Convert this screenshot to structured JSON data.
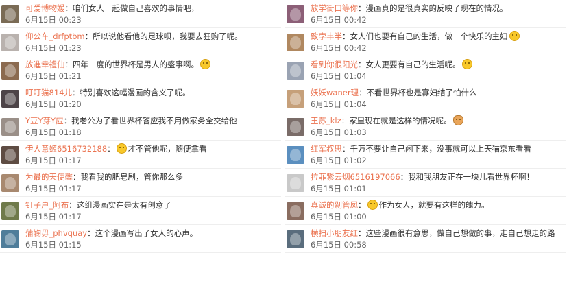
{
  "left": [
    {
      "user": "可爱博物嫒",
      "text": "咱们女人一起做自己喜欢的事情吧，",
      "emoji": "",
      "after": "",
      "date": "6月15日 00:23",
      "avatar": "#7a6b55"
    },
    {
      "user": "仰公车_drfptbm",
      "text": "所以说他看他的足球呗，我要去狂购了呢。",
      "emoji": "",
      "after": "",
      "date": "6月15日 01:23",
      "avatar": "#b9b2ae"
    },
    {
      "user": "放進幸禮仙",
      "text": "四年一度的世界杯是男人的盛事啊。",
      "emoji": "smile",
      "after": "",
      "date": "6月15日 01:21",
      "avatar": "#8b6a4f"
    },
    {
      "user": "叮叮猫814儿",
      "text": "特别喜欢这幅漫画的含义了呢。",
      "emoji": "",
      "after": "",
      "date": "6月15日 01:20",
      "avatar": "#4d4448"
    },
    {
      "user": "Y豆Y芽Y应",
      "text": "我老公为了看世界杯答应我不用做家务全交给他",
      "emoji": "",
      "after": "",
      "date": "6月15日 01:18",
      "avatar": "#9a8f88"
    },
    {
      "user": "伊人意姬6516732188",
      "text": "",
      "emoji": "smile",
      "after": "才不管他呢，随便拿看",
      "date": "6月15日 01:17",
      "avatar": "#5e4c43"
    },
    {
      "user": "为最的天使馨",
      "text": "我看我的肥皂剧，管你那么多",
      "emoji": "",
      "after": "",
      "date": "6月15日 01:17",
      "avatar": "#a88970"
    },
    {
      "user": "钉子户_阿布",
      "text": "这组漫画实在是太有创意了",
      "emoji": "",
      "after": "",
      "date": "6月15日 01:17",
      "avatar": "#6f7a4a"
    },
    {
      "user": "蒲鞠毋_phvquay",
      "text": "这个漫画写出了女人的心声。",
      "emoji": "",
      "after": "",
      "date": "6月15日 01:15",
      "avatar": "#4f7d9a"
    }
  ],
  "right": [
    {
      "user": "放学街口等你",
      "text": "漫画真的是很真实的反映了现在的情况。",
      "emoji": "",
      "after": "",
      "date": "6月15日 00:42",
      "avatar": "#8c5f77"
    },
    {
      "user": "致孛丰半",
      "text": "女人们也要有自己的生活，做一个快乐的主妇",
      "emoji": "smile",
      "after": "",
      "date": "6月15日 00:42",
      "avatar": "#b08860"
    },
    {
      "user": "看到你很阳光",
      "text": "女人更要有自己的生活呢。",
      "emoji": "smile",
      "after": "",
      "date": "6月15日 01:04",
      "avatar": "#9aa3b3"
    },
    {
      "user": "妖妖waner理",
      "text": "不看世界杯也是寡妇结了怕什么",
      "emoji": "",
      "after": "",
      "date": "6月15日 01:04",
      "avatar": "#c6a07a"
    },
    {
      "user": "王苏_klz",
      "text": "家里现在就是这样的情况呢。",
      "emoji": "cat",
      "after": "",
      "date": "6月15日 01:03",
      "avatar": "#7a6c68"
    },
    {
      "user": "红军叔思",
      "text": "千万不要让自己闲下来，没事就可以上天猫京东看看",
      "emoji": "",
      "after": "",
      "date": "6月15日 01:02",
      "avatar": "#5b8fbf"
    },
    {
      "user": "拉菲紫云烟6516197066",
      "text": "我和我朋友正在一块儿看世界杯啊！",
      "emoji": "",
      "after": "",
      "date": "6月15日 01:01",
      "avatar": "#c9c9c9"
    },
    {
      "user": "真诚的剁管凤",
      "text": "",
      "emoji": "smile",
      "after": "作为女人，就要有这样的魄力。",
      "date": "6月15日 01:00",
      "avatar": "#8a6d60"
    },
    {
      "user": "横扫小朋友红",
      "text": "这些漫画很有意思，做自己想做的事，走自己想走的路",
      "emoji": "",
      "after": "",
      "date": "6月15日 00:58",
      "avatar": "#5a6d7d"
    }
  ]
}
